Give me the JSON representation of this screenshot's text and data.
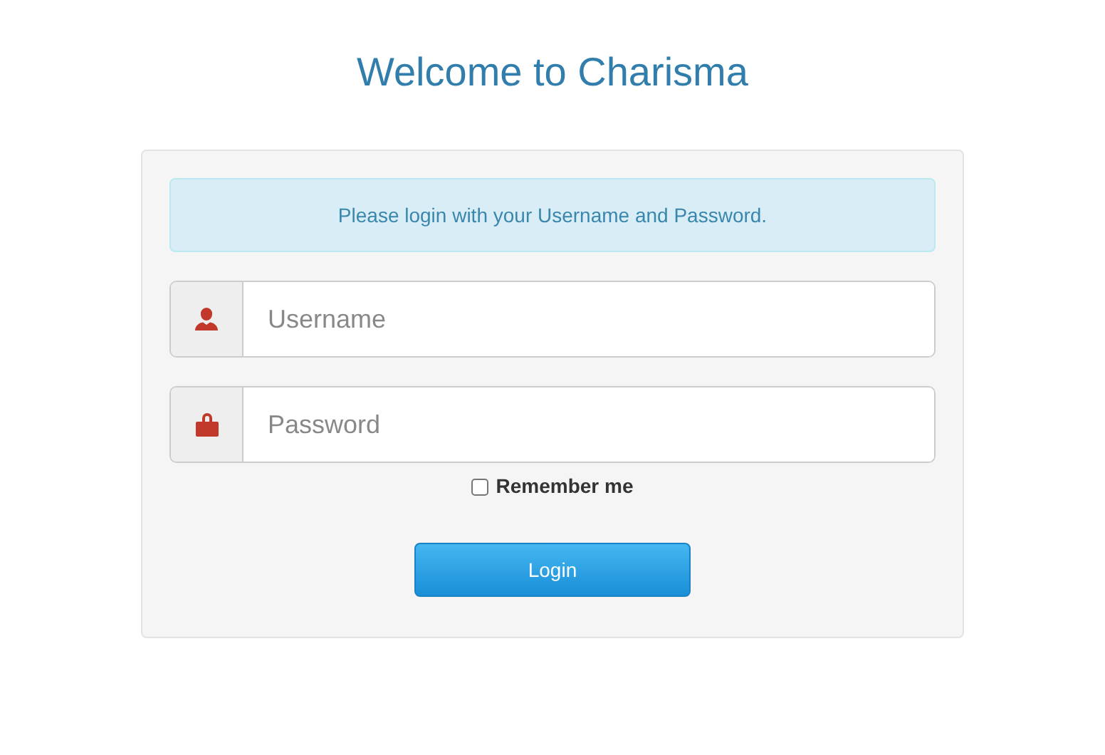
{
  "title": "Welcome to Charisma",
  "message": "Please login with your Username and Password.",
  "fields": [
    {
      "kind": "user",
      "placeholder": "Username"
    },
    {
      "kind": "lock",
      "placeholder": "Password"
    }
  ],
  "remember": {
    "label": "Remember me",
    "checked": false
  },
  "button": "Login"
}
